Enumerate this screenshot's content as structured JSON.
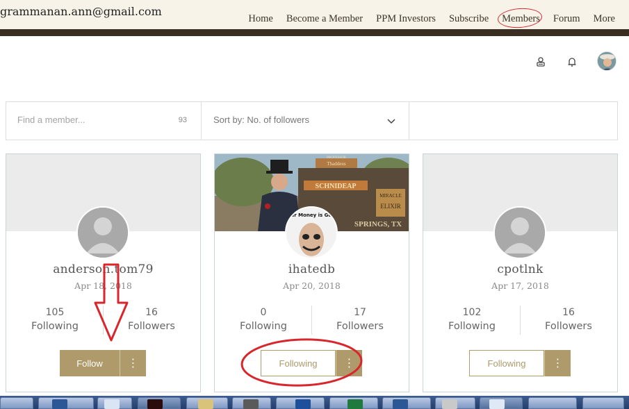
{
  "header": {
    "email": "grammanan.ann@gmail.com",
    "nav": [
      {
        "label": "Home"
      },
      {
        "label": "Become a Member"
      },
      {
        "label": "PPM Investors"
      },
      {
        "label": "Subscribe"
      },
      {
        "label": "Members"
      },
      {
        "label": "Forum"
      },
      {
        "label": "More"
      }
    ]
  },
  "toolbar": {
    "icons": [
      "members-list-icon",
      "bell-icon",
      "profile-avatar"
    ]
  },
  "filter": {
    "search_placeholder": "Find a member...",
    "member_count": "93",
    "sort_label": "Sort by: No. of followers"
  },
  "members": [
    {
      "name": "anderson.tom79",
      "joined": "Apr 18, 2018",
      "following_count": "105",
      "following_label": "Following",
      "followers_count": "16",
      "followers_label": "Followers",
      "button_label": "Follow",
      "more_label": "⋮"
    },
    {
      "name": "ihatedb",
      "joined": "Apr 20, 2018",
      "following_count": "0",
      "following_label": "Following",
      "followers_count": "17",
      "followers_label": "Followers",
      "button_label": "Following",
      "more_label": "⋮",
      "cover_sign_texts": [
        "PROFESSOR",
        "Thaddeus",
        "SCHNIDEAP",
        "MIRACLE",
        "ELIXIR",
        "SPRINGS, TX"
      ],
      "avatar_caption": "Your Money is Gone"
    },
    {
      "name": "cpotlnk",
      "joined": "Apr 17, 2018",
      "following_count": "102",
      "following_label": "Following",
      "followers_count": "16",
      "followers_label": "Followers",
      "button_label": "Following",
      "more_label": "⋮"
    }
  ],
  "colors": {
    "accent": "#ae9a6a",
    "header_bg": "#f7f3e8",
    "header_bar": "#3a2d22",
    "annotation_red": "#d8262c"
  }
}
